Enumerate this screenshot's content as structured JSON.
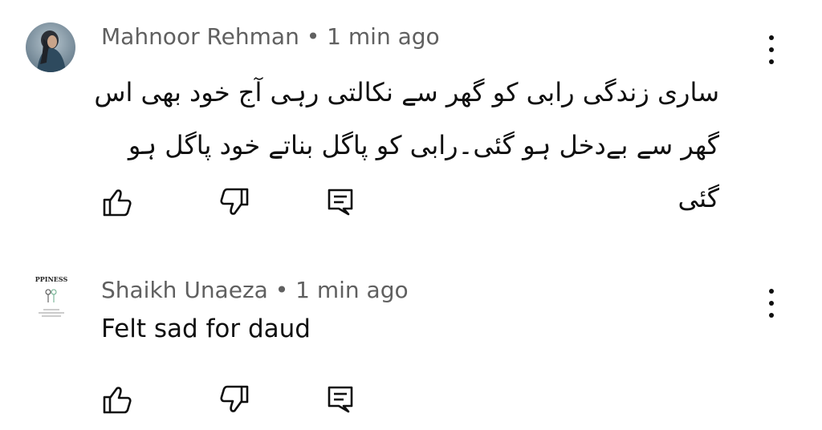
{
  "comments": [
    {
      "author": "Mahnoor Rehman",
      "separator": "•",
      "time": "1 min ago",
      "text": "ساری زندگی رابی کو گھر سے نکالتی رہی آج خود بھی اس گھر سے بےدخل ہو گئی۔رابی کو پاگل بناتے خود پاگل ہو گئی",
      "avatar_icon": "user-photo-avatar"
    },
    {
      "author": "Shaikh Unaeza",
      "separator": "•",
      "time": "1 min ago",
      "text": "Felt sad for daud",
      "avatar_icon": "happiness-book-avatar",
      "avatar_text": "PPINESS"
    }
  ],
  "icons": {
    "like": "thumbs-up-icon",
    "dislike": "thumbs-down-icon",
    "reply": "reply-comment-icon",
    "menu": "more-vertical-icon"
  },
  "colors": {
    "text_primary": "#0f0f0f",
    "text_secondary": "#606060",
    "background": "#ffffff"
  }
}
